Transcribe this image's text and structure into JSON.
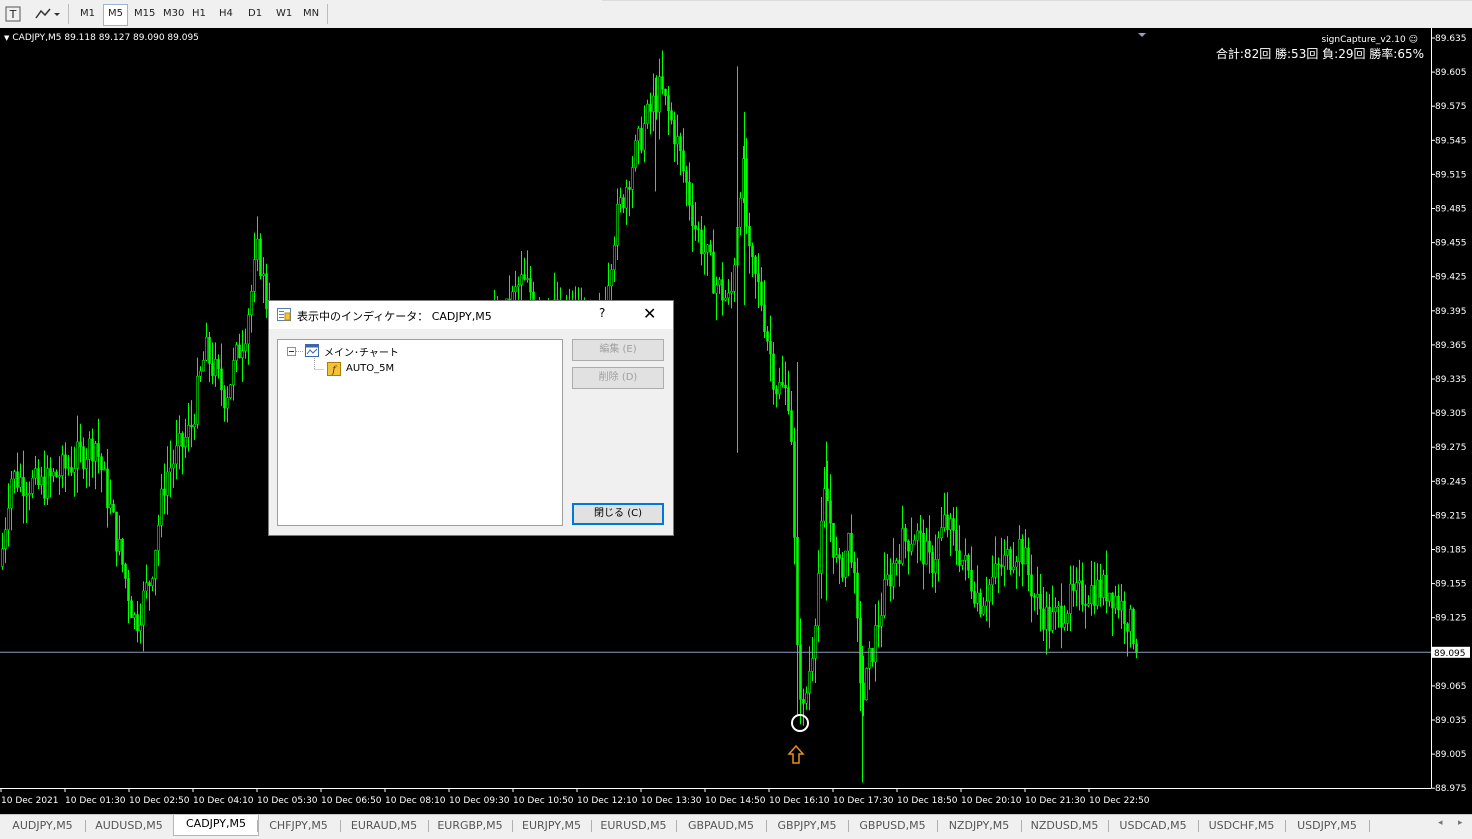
{
  "toolbar": {
    "timeframes": [
      "M1",
      "M5",
      "M15",
      "M30",
      "H1",
      "H4",
      "D1",
      "W1",
      "MN"
    ],
    "active_timeframe": "M5"
  },
  "chart": {
    "symbol_info": "CADJPY,M5  89.118 89.127 89.090 89.095",
    "sign_capture": "signCapture_v2.10",
    "stats": "合計:82回 勝:53回 負:29回 勝率:65%",
    "current_price_label": "89.095",
    "price_axis": [
      "89.635",
      "89.605",
      "89.575",
      "89.545",
      "89.515",
      "89.485",
      "89.455",
      "89.425",
      "89.395",
      "89.365",
      "89.335",
      "89.305",
      "89.275",
      "89.245",
      "89.215",
      "89.185",
      "89.155",
      "89.125",
      "89.095",
      "89.065",
      "89.035",
      "89.005",
      "88.975"
    ],
    "time_axis": [
      "10 Dec 2021",
      "10 Dec 01:30",
      "10 Dec 02:50",
      "10 Dec 04:10",
      "10 Dec 05:30",
      "10 Dec 06:50",
      "10 Dec 08:10",
      "10 Dec 09:30",
      "10 Dec 10:50",
      "10 Dec 12:10",
      "10 Dec 13:30",
      "10 Dec 14:50",
      "10 Dec 16:10",
      "10 Dec 17:30",
      "10 Dec 18:50",
      "10 Dec 20:10",
      "10 Dec 21:30",
      "10 Dec 22:50"
    ],
    "candle_color": "#00ff00",
    "signal_arrow_color": "#e8901c"
  },
  "dialog": {
    "title": "表示中のインディケータ： CADJPY,M5",
    "help": "?",
    "tree_root": "メイン･チャート",
    "tree_child": "AUTO_5M",
    "edit_label": "編集 (E)",
    "delete_label": "削除 (D)",
    "close_label": "閉じる (C)"
  },
  "tabs": {
    "items": [
      "AUDJPY,M5",
      "AUDUSD,M5",
      "CADJPY,M5",
      "CHFJPY,M5",
      "EURAUD,M5",
      "EURGBP,M5",
      "EURJPY,M5",
      "EURUSD,M5",
      "GBPAUD,M5",
      "GBPJPY,M5",
      "GBPUSD,M5",
      "NZDJPY,M5",
      "NZDUSD,M5",
      "USDCAD,M5",
      "USDCHF,M5",
      "USDJPY,M5"
    ],
    "active": "CADJPY,M5"
  }
}
